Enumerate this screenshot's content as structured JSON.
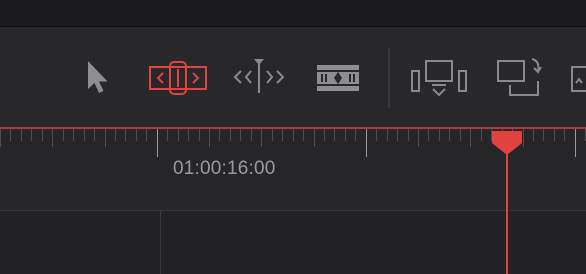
{
  "timeline": {
    "timecode_label": "01:00:16:00",
    "playhead_color": "#e1413f",
    "accent_active": "#e1413f"
  },
  "toolbar": {
    "tools": [
      {
        "name": "selection-mode",
        "icon": "arrow-cursor-icon",
        "active": false
      },
      {
        "name": "trim-edit-mode",
        "icon": "trim-edit-icon",
        "active": true
      },
      {
        "name": "dynamic-trim-mode",
        "icon": "dynamic-trim-icon",
        "active": false
      },
      {
        "name": "blade-edit-mode",
        "icon": "blade-icon",
        "active": false
      },
      {
        "name": "insert-clip",
        "icon": "insert-clip-icon",
        "active": false
      },
      {
        "name": "overwrite-clip",
        "icon": "overwrite-clip-icon",
        "active": false
      },
      {
        "name": "replace-clip",
        "icon": "replace-clip-icon",
        "active": false
      }
    ]
  }
}
